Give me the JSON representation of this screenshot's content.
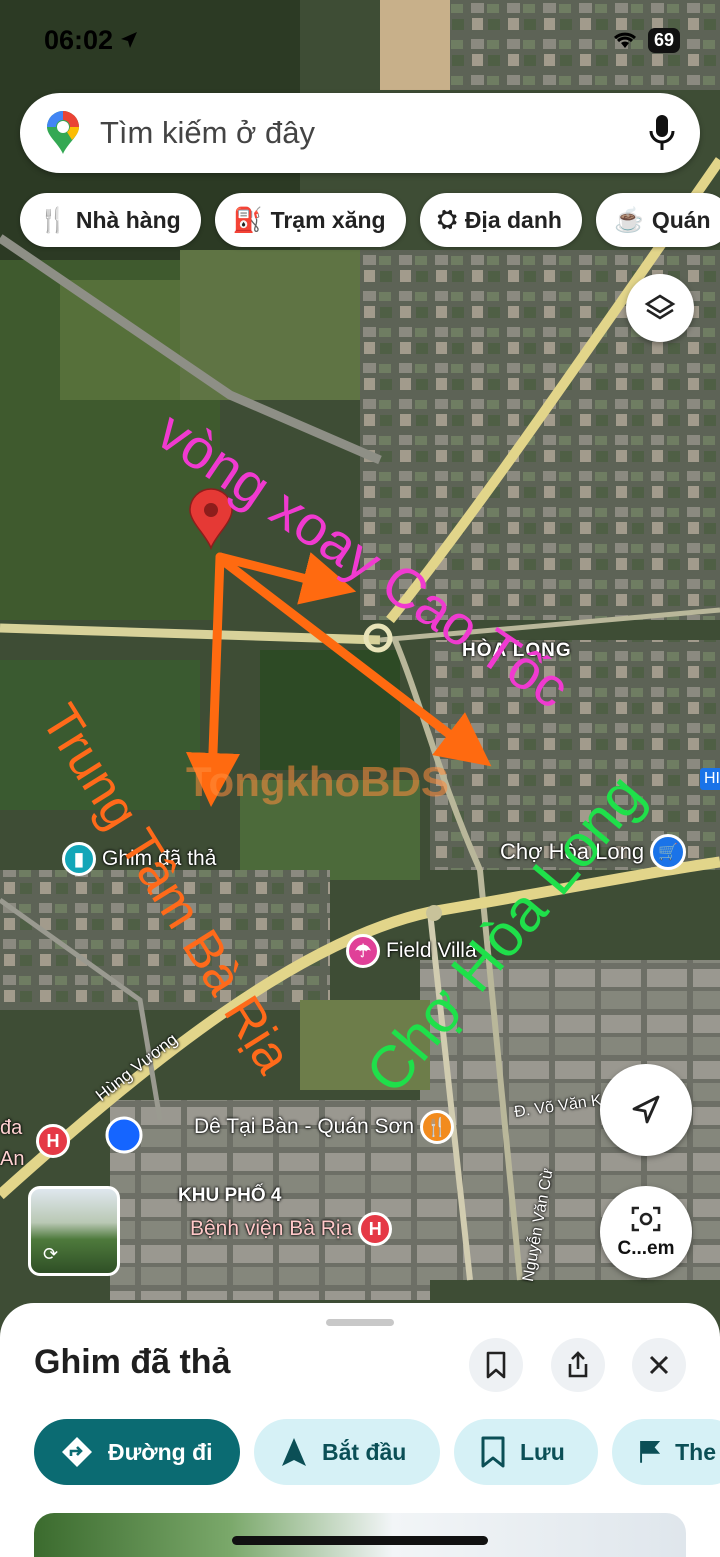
{
  "status_bar": {
    "time": "06:02",
    "battery": "69"
  },
  "search": {
    "placeholder": "Tìm kiếm ở đây"
  },
  "chips": [
    {
      "label": "Nhà hàng",
      "icon": "restaurant-icon"
    },
    {
      "label": "Trạm xăng",
      "icon": "gas-station-icon"
    },
    {
      "label": "Địa danh",
      "icon": "landmark-icon"
    },
    {
      "label": "Quán",
      "icon": "cafe-icon"
    }
  ],
  "map": {
    "labels": {
      "hoa_long": "HÒA LONG",
      "dropped_pin": "Ghim đã thả",
      "cho_hoa_long": "Chợ Hòa Long",
      "field_villa": "Field Villa",
      "hung_vuong": "Hùng Vương",
      "vo_van": "Đ. Võ Văn K",
      "de_tai_ban": "Dê Tại Bàn - Quán Sơn",
      "khu_pho_4": "KHU PHỐ 4",
      "benh_vien": "Bệnh viện Bà Rịa",
      "nguyen_van_cu": "Nguyễn Văn Cừ",
      "left_da": "đa",
      "left_an": "An",
      "hi": "HI"
    },
    "annotations": {
      "vong_xoay": "vòng xoay Cao Tốc",
      "trung_tam": "Trung Tâm Bà Rịa",
      "cho_hoa_long": "Chợ Hòa Long"
    },
    "watermark": "TongkhoBDS",
    "streetview_label": "C...em"
  },
  "colors": {
    "annot_pink": "#f03ad0",
    "annot_orange": "#ff6a1a",
    "annot_green": "#1fe04a",
    "arrow": "#ff6a10",
    "primary": "#0b6b72",
    "pin": "#e53935"
  },
  "sheet": {
    "title": "Ghim đã thả",
    "actions": [
      {
        "label": "Đường đi",
        "icon": "directions-icon"
      },
      {
        "label": "Bắt đầu",
        "icon": "navigation-arrow-icon"
      },
      {
        "label": "Lưu",
        "icon": "bookmark-icon"
      },
      {
        "label": "The",
        "icon": "flag-icon"
      }
    ]
  }
}
